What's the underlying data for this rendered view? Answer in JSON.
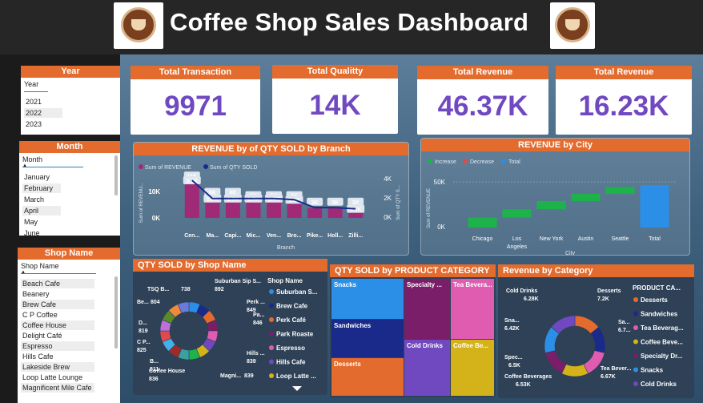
{
  "header": {
    "title": "Coffee Shop Sales Dashboard"
  },
  "slicers": {
    "year": {
      "title": "Year",
      "field": "Year",
      "items": [
        "2021",
        "2022",
        "2023"
      ]
    },
    "month": {
      "title": "Month",
      "field": "Month",
      "items": [
        "January",
        "February",
        "March",
        "April",
        "May",
        "June"
      ]
    },
    "shop": {
      "title": "Shop Name",
      "field": "Shop Name",
      "items": [
        "Beach Cafe",
        "Beanery",
        "Brew Cafe",
        "C P Coffee",
        "Coffee House",
        "Delight Café",
        "Espresso",
        "Hills Cafe",
        "Lakeside Brew",
        "Loop Latte Lounge",
        "Magnificent Mile Cafe"
      ]
    }
  },
  "kpis": [
    {
      "title": "Total Transaction",
      "value": "9971"
    },
    {
      "title": "Total Qualitty",
      "value": "14K"
    },
    {
      "title": "Total Revenue",
      "value": "46.37K"
    },
    {
      "title": "Total Revenue",
      "value": "16.23K"
    }
  ],
  "colors": {
    "accent": "#e36b2d",
    "kpi_value": "#7048c0",
    "revenue_bar": "#a02a78",
    "qty_line": "#1a2a8a"
  },
  "chart_data": [
    {
      "type": "bar",
      "title": "REVENUE by of QTY SOLD by Branch",
      "xlabel": "Branch",
      "ylabel": "Sum of REVENU...",
      "y2label": "Sum of QTY S...",
      "legend": [
        "Sum of REVENUE",
        "Sum of QTY SOLD"
      ],
      "categories": [
        "Cen...",
        "Ma...",
        "Capi...",
        "Mic...",
        "Ven...",
        "Bro...",
        "Pike...",
        "Holl...",
        "Zilli..."
      ],
      "series": [
        {
          "name": "Sum of REVENUE",
          "values": [
            11000,
            6000,
            6000,
            5000,
            5000,
            5000,
            3000,
            3000,
            3000
          ],
          "labels": [
            "11K",
            "6K",
            "6K",
            "5K",
            "5K",
            "5K",
            "3K",
            "3K",
            "3K"
          ]
        },
        {
          "name": "Sum of QTY SOLD",
          "values": [
            3300,
            1700,
            1700,
            1700,
            1700,
            1600,
            900,
            900,
            800
          ],
          "labels": [
            "3.3K",
            "1.7K",
            "1.7K",
            "1.7K",
            "1.7K",
            "1.6K",
            "",
            "",
            "0.8K"
          ]
        }
      ],
      "yticks": [
        "10K",
        "0K"
      ],
      "y2ticks": [
        "4K",
        "2K",
        "0K"
      ]
    },
    {
      "type": "bar",
      "subtype": "waterfall",
      "title": "REVENUE by City",
      "xlabel": "City",
      "ylabel": "Sum of REVENUE",
      "legend": [
        "Increase",
        "Decrease",
        "Total"
      ],
      "categories": [
        "Chicago",
        "Los Angeles",
        "New York",
        "Austin",
        "Seattle",
        "Total"
      ],
      "values": [
        11000,
        9000,
        9000,
        8000,
        7500,
        46370
      ],
      "yticks": [
        "50K",
        "0K"
      ],
      "ylim": [
        0,
        50000
      ]
    },
    {
      "type": "pie",
      "subtype": "donut",
      "title": "QTY SOLD by Shop Name",
      "legend_title": "Shop Name",
      "legend": [
        "Suburban S...",
        "Brew Cafe",
        "Perk Café",
        "Park Roaste",
        "Espresso",
        "Hills Cafe",
        "Loop Latte ..."
      ],
      "labels": [
        {
          "name": "TSQ B...",
          "value": "738"
        },
        {
          "name": "Suburban Sip S...",
          "value": "892"
        },
        {
          "name": "Be...",
          "value": "804"
        },
        {
          "name": "Perk ...",
          "value": "849"
        },
        {
          "name": "Pa...",
          "value": "846"
        },
        {
          "name": "D...",
          "value": "819"
        },
        {
          "name": "C P...",
          "value": "825"
        },
        {
          "name": "B...",
          "value": "811"
        },
        {
          "name": "Hills ...",
          "value": "839"
        },
        {
          "name": "Coffee House",
          "value": "836"
        },
        {
          "name": "Magni...",
          "value": "839"
        }
      ]
    },
    {
      "type": "heatmap",
      "subtype": "treemap",
      "title": "QTY SOLD by PRODUCT CATEGORY",
      "categories": [
        "Snacks",
        "Specialty ...",
        "Tea Bevera...",
        "Sandwiches",
        "Cold Drinks",
        "Desserts",
        "Coffee Be..."
      ]
    },
    {
      "type": "pie",
      "subtype": "donut",
      "title": "Revenue by Category",
      "legend_title": "PRODUCT CA...",
      "legend": [
        "Desserts",
        "Sandwiches",
        "Tea Beverag...",
        "Coffee Beve...",
        "Specialty Dr...",
        "Snacks",
        "Cold Drinks"
      ],
      "labels": [
        {
          "name": "Cold Drinks",
          "value": "6.28K"
        },
        {
          "name": "Desserts",
          "value": "7.2K"
        },
        {
          "name": "Sna...",
          "value": "6.42K"
        },
        {
          "name": "Sa...",
          "value": "6.7..."
        },
        {
          "name": "Spec...",
          "value": "6.5K"
        },
        {
          "name": "Tea Bever...",
          "value": "6.67K"
        },
        {
          "name": "Coffee Beverages",
          "value": "6.53K"
        }
      ]
    }
  ]
}
